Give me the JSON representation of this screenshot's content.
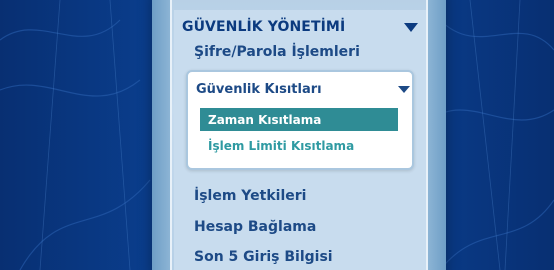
{
  "menu": {
    "header_title": "GÜVENLİK YÖNETİMİ",
    "items": [
      {
        "label": "Şifre/Parola İşlemleri"
      },
      {
        "label": "İşlem Yetkileri"
      },
      {
        "label": "Hesap Bağlama"
      },
      {
        "label": "Son 5 Giriş Bilgisi"
      }
    ],
    "submenu": {
      "title": "Güvenlik Kısıtları",
      "items": [
        {
          "label": "Zaman Kısıtlama",
          "selected": true
        },
        {
          "label": "İşlem Limiti Kısıtlama",
          "selected": false
        }
      ]
    }
  },
  "colors": {
    "background": "#0b3a86",
    "panel": "#c8dcee",
    "header_text": "#0b3a7f",
    "item_text": "#1d4a86",
    "selected_bg": "#2f8c95",
    "link_text": "#2f9aa2"
  },
  "icons": {
    "header_toggle": "triangle-down-icon",
    "submenu_toggle": "triangle-down-icon"
  }
}
